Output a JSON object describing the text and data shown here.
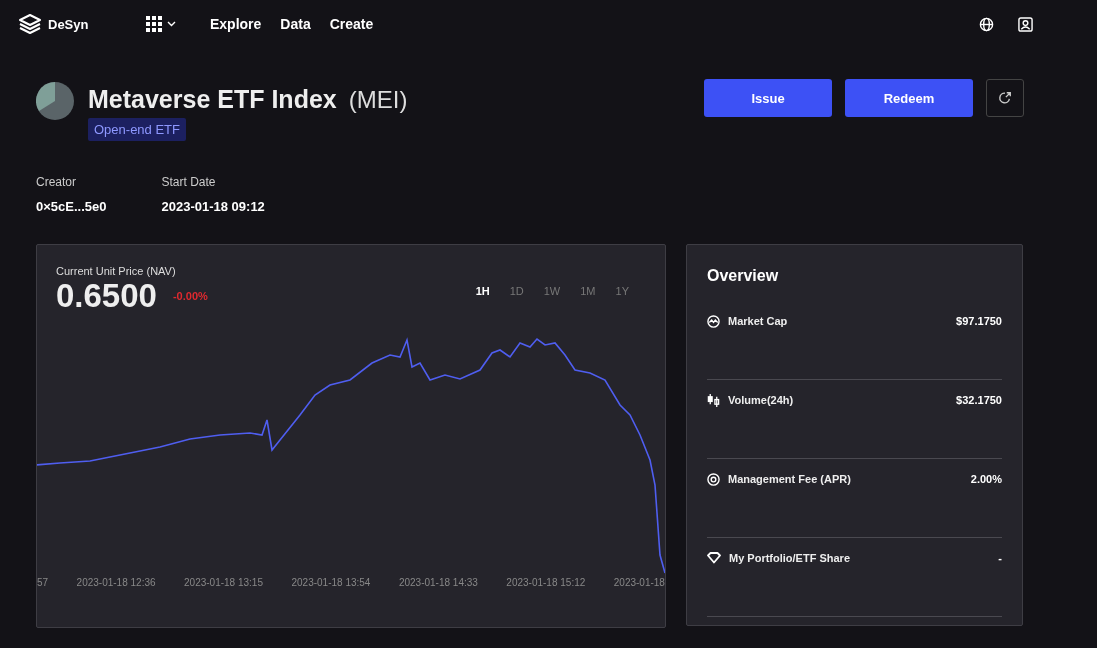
{
  "nav": {
    "brand": "DeSyn",
    "links": [
      "Explore",
      "Data",
      "Create"
    ]
  },
  "header": {
    "name": "Metaverse ETF Index",
    "symbol": "(MEI)",
    "tag": "Open-end ETF",
    "buttons": [
      "Issue",
      "Redeem"
    ]
  },
  "info": [
    {
      "label": "Creator",
      "value": "0×5cE...5e0"
    },
    {
      "label": "Start Date",
      "value": "2023-01-18 09:12"
    }
  ],
  "price_card": {
    "label": "Current Unit Price (NAV)",
    "price": "0.6500",
    "change": "-0.00%",
    "ranges": [
      {
        "label": "1H",
        "selected": true
      },
      {
        "label": "1D",
        "selected": false
      },
      {
        "label": "1W",
        "selected": false
      },
      {
        "label": "1M",
        "selected": false
      },
      {
        "label": "1Y",
        "selected": false
      }
    ],
    "x_labels": [
      "57",
      "2023-01-18 12:36",
      "2023-01-18 13:15",
      "2023-01-18 13:54",
      "2023-01-18 14:33",
      "2023-01-18 15:12",
      "2023-01-18"
    ]
  },
  "overview": {
    "title": "Overview",
    "rows": [
      {
        "kind": "market",
        "label": "Market Cap",
        "value": "$97.1750"
      },
      {
        "kind": "volume",
        "label": "Volume(24h)",
        "value": "$32.1750"
      },
      {
        "kind": "fee",
        "label": "Management Fee (APR)",
        "value": "2.00%"
      },
      {
        "kind": "portfolio",
        "label": "My Portfolio/ETF Share",
        "value": "-"
      }
    ]
  }
}
